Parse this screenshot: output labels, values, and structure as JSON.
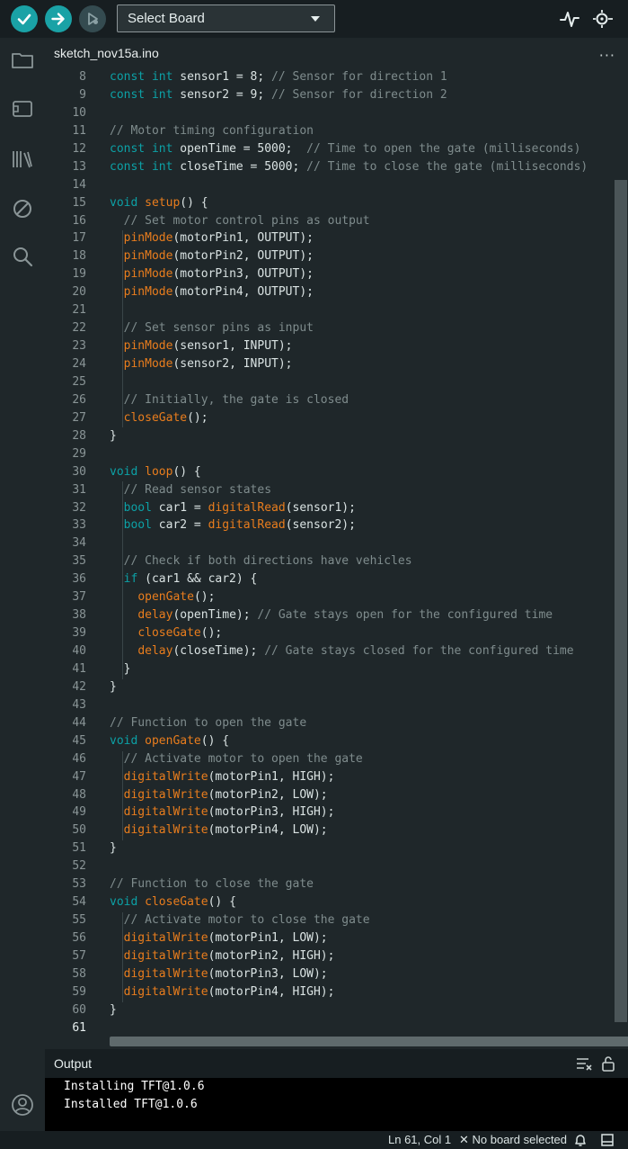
{
  "toolbar": {
    "board_select": "Select Board"
  },
  "tab": {
    "name": "sketch_nov15a.ino",
    "more": "···"
  },
  "code": {
    "lines": [
      {
        "n": "8",
        "html": "<span class=\"kw\">const int</span> sensor1 = 8; <span class=\"cm\">// Sensor for direction 1</span>"
      },
      {
        "n": "9",
        "html": "<span class=\"kw\">const int</span> sensor2 = 9; <span class=\"cm\">// Sensor for direction 2</span>"
      },
      {
        "n": "10",
        "html": ""
      },
      {
        "n": "11",
        "html": "<span class=\"cm\">// Motor timing configuration</span>"
      },
      {
        "n": "12",
        "html": "<span class=\"kw\">const int</span> openTime = 5000;  <span class=\"cm\">// Time to open the gate (milliseconds)</span>"
      },
      {
        "n": "13",
        "html": "<span class=\"kw\">const int</span> closeTime = 5000; <span class=\"cm\">// Time to close the gate (milliseconds)</span>"
      },
      {
        "n": "14",
        "html": ""
      },
      {
        "n": "15",
        "html": "<span class=\"kw\">void</span> <span class=\"fn\">setup</span>() {"
      },
      {
        "n": "16",
        "html": "  <span class=\"cm\">// Set motor control pins as output</span>"
      },
      {
        "n": "17",
        "html": "  <span class=\"fn\">pinMode</span>(motorPin1, OUTPUT);"
      },
      {
        "n": "18",
        "html": "  <span class=\"fn\">pinMode</span>(motorPin2, OUTPUT);"
      },
      {
        "n": "19",
        "html": "  <span class=\"fn\">pinMode</span>(motorPin3, OUTPUT);"
      },
      {
        "n": "20",
        "html": "  <span class=\"fn\">pinMode</span>(motorPin4, OUTPUT);"
      },
      {
        "n": "21",
        "html": ""
      },
      {
        "n": "22",
        "html": "  <span class=\"cm\">// Set sensor pins as input</span>"
      },
      {
        "n": "23",
        "html": "  <span class=\"fn\">pinMode</span>(sensor1, INPUT);"
      },
      {
        "n": "24",
        "html": "  <span class=\"fn\">pinMode</span>(sensor2, INPUT);"
      },
      {
        "n": "25",
        "html": ""
      },
      {
        "n": "26",
        "html": "  <span class=\"cm\">// Initially, the gate is closed</span>"
      },
      {
        "n": "27",
        "html": "  <span class=\"fn\">closeGate</span>();"
      },
      {
        "n": "28",
        "html": "}"
      },
      {
        "n": "29",
        "html": ""
      },
      {
        "n": "30",
        "html": "<span class=\"kw\">void</span> <span class=\"fn\">loop</span>() {"
      },
      {
        "n": "31",
        "html": "  <span class=\"cm\">// Read sensor states</span>"
      },
      {
        "n": "32",
        "html": "  <span class=\"kw\">bool</span> car1 = <span class=\"fn\">digitalRead</span>(sensor1);"
      },
      {
        "n": "33",
        "html": "  <span class=\"kw\">bool</span> car2 = <span class=\"fn\">digitalRead</span>(sensor2);"
      },
      {
        "n": "34",
        "html": ""
      },
      {
        "n": "35",
        "html": "  <span class=\"cm\">// Check if both directions have vehicles</span>"
      },
      {
        "n": "36",
        "html": "  <span class=\"kw\">if</span> (car1 &amp;&amp; car2) {"
      },
      {
        "n": "37",
        "html": "    <span class=\"fn\">openGate</span>();"
      },
      {
        "n": "38",
        "html": "    <span class=\"fn\">delay</span>(openTime); <span class=\"cm\">// Gate stays open for the configured time</span>"
      },
      {
        "n": "39",
        "html": "    <span class=\"fn\">closeGate</span>();"
      },
      {
        "n": "40",
        "html": "    <span class=\"fn\">delay</span>(closeTime); <span class=\"cm\">// Gate stays closed for the configured time</span>"
      },
      {
        "n": "41",
        "html": "  }"
      },
      {
        "n": "42",
        "html": "}"
      },
      {
        "n": "43",
        "html": ""
      },
      {
        "n": "44",
        "html": "<span class=\"cm\">// Function to open the gate</span>"
      },
      {
        "n": "45",
        "html": "<span class=\"kw\">void</span> <span class=\"fn\">openGate</span>() {"
      },
      {
        "n": "46",
        "html": "  <span class=\"cm\">// Activate motor to open the gate</span>"
      },
      {
        "n": "47",
        "html": "  <span class=\"fn\">digitalWrite</span>(motorPin1, HIGH);"
      },
      {
        "n": "48",
        "html": "  <span class=\"fn\">digitalWrite</span>(motorPin2, LOW);"
      },
      {
        "n": "49",
        "html": "  <span class=\"fn\">digitalWrite</span>(motorPin3, HIGH);"
      },
      {
        "n": "50",
        "html": "  <span class=\"fn\">digitalWrite</span>(motorPin4, LOW);"
      },
      {
        "n": "51",
        "html": "}"
      },
      {
        "n": "52",
        "html": ""
      },
      {
        "n": "53",
        "html": "<span class=\"cm\">// Function to close the gate</span>"
      },
      {
        "n": "54",
        "html": "<span class=\"kw\">void</span> <span class=\"fn\">closeGate</span>() {"
      },
      {
        "n": "55",
        "html": "  <span class=\"cm\">// Activate motor to close the gate</span>"
      },
      {
        "n": "56",
        "html": "  <span class=\"fn\">digitalWrite</span>(motorPin1, LOW);"
      },
      {
        "n": "57",
        "html": "  <span class=\"fn\">digitalWrite</span>(motorPin2, HIGH);"
      },
      {
        "n": "58",
        "html": "  <span class=\"fn\">digitalWrite</span>(motorPin3, LOW);"
      },
      {
        "n": "59",
        "html": "  <span class=\"fn\">digitalWrite</span>(motorPin4, HIGH);"
      },
      {
        "n": "60",
        "html": "}"
      },
      {
        "n": "61",
        "html": "",
        "active": true
      }
    ]
  },
  "output": {
    "title": "Output",
    "lines": [
      "Installing TFT@1.0.6",
      "Installed TFT@1.0.6"
    ]
  },
  "status": {
    "cursor": "Ln 61, Col 1",
    "board": "✕ No board selected"
  },
  "colors": {
    "accent": "#1aa2a6",
    "keyword": "#0ca1a6",
    "function": "#e97d1d",
    "comment": "#7f8c8d",
    "background": "#1f272a"
  },
  "icons": {
    "verify": "check-icon",
    "upload": "arrow-right-icon",
    "debug": "debug-icon",
    "plotter": "serial-plotter-icon",
    "monitor": "serial-monitor-icon",
    "sketchbook": "folder-icon",
    "boards": "board-icon",
    "library": "library-icon",
    "debug_side": "no-entry-icon",
    "search": "search-icon",
    "account": "account-icon"
  }
}
